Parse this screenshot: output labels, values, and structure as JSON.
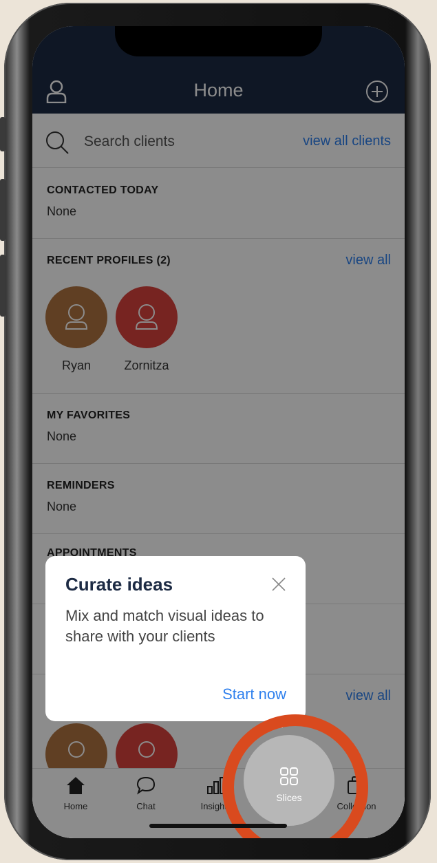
{
  "header": {
    "title": "Home"
  },
  "search": {
    "placeholder": "Search clients",
    "link": "view all clients"
  },
  "contacted_today": {
    "title": "CONTACTED TODAY",
    "value": "None"
  },
  "recent_profiles": {
    "title": "RECENT PROFILES (2)",
    "link": "view all",
    "profiles": [
      {
        "name": "Ryan",
        "color": "#b07340"
      },
      {
        "name": "Zornitza",
        "color": "#d9423c"
      }
    ]
  },
  "favorites": {
    "title": "MY FAVORITES",
    "value": "None"
  },
  "reminders": {
    "title": "REMINDERS",
    "value": "None"
  },
  "appointments": {
    "title": "APPOINTMENTS"
  },
  "lower_section": {
    "link": "view all"
  },
  "popup": {
    "title": "Curate ideas",
    "body": "Mix and match visual ideas to share with your clients",
    "cta": "Start now"
  },
  "tabs": [
    {
      "label": "Home",
      "icon": "home-icon"
    },
    {
      "label": "Chat",
      "icon": "chat-icon"
    },
    {
      "label": "Insights",
      "icon": "insights-icon"
    },
    {
      "label": "Slices",
      "icon": "slices-icon"
    },
    {
      "label": "Collection",
      "icon": "collection-icon"
    }
  ],
  "colors": {
    "header": "#1d2b44",
    "link": "#2f80ed",
    "highlight_ring": "#d94a1e"
  }
}
